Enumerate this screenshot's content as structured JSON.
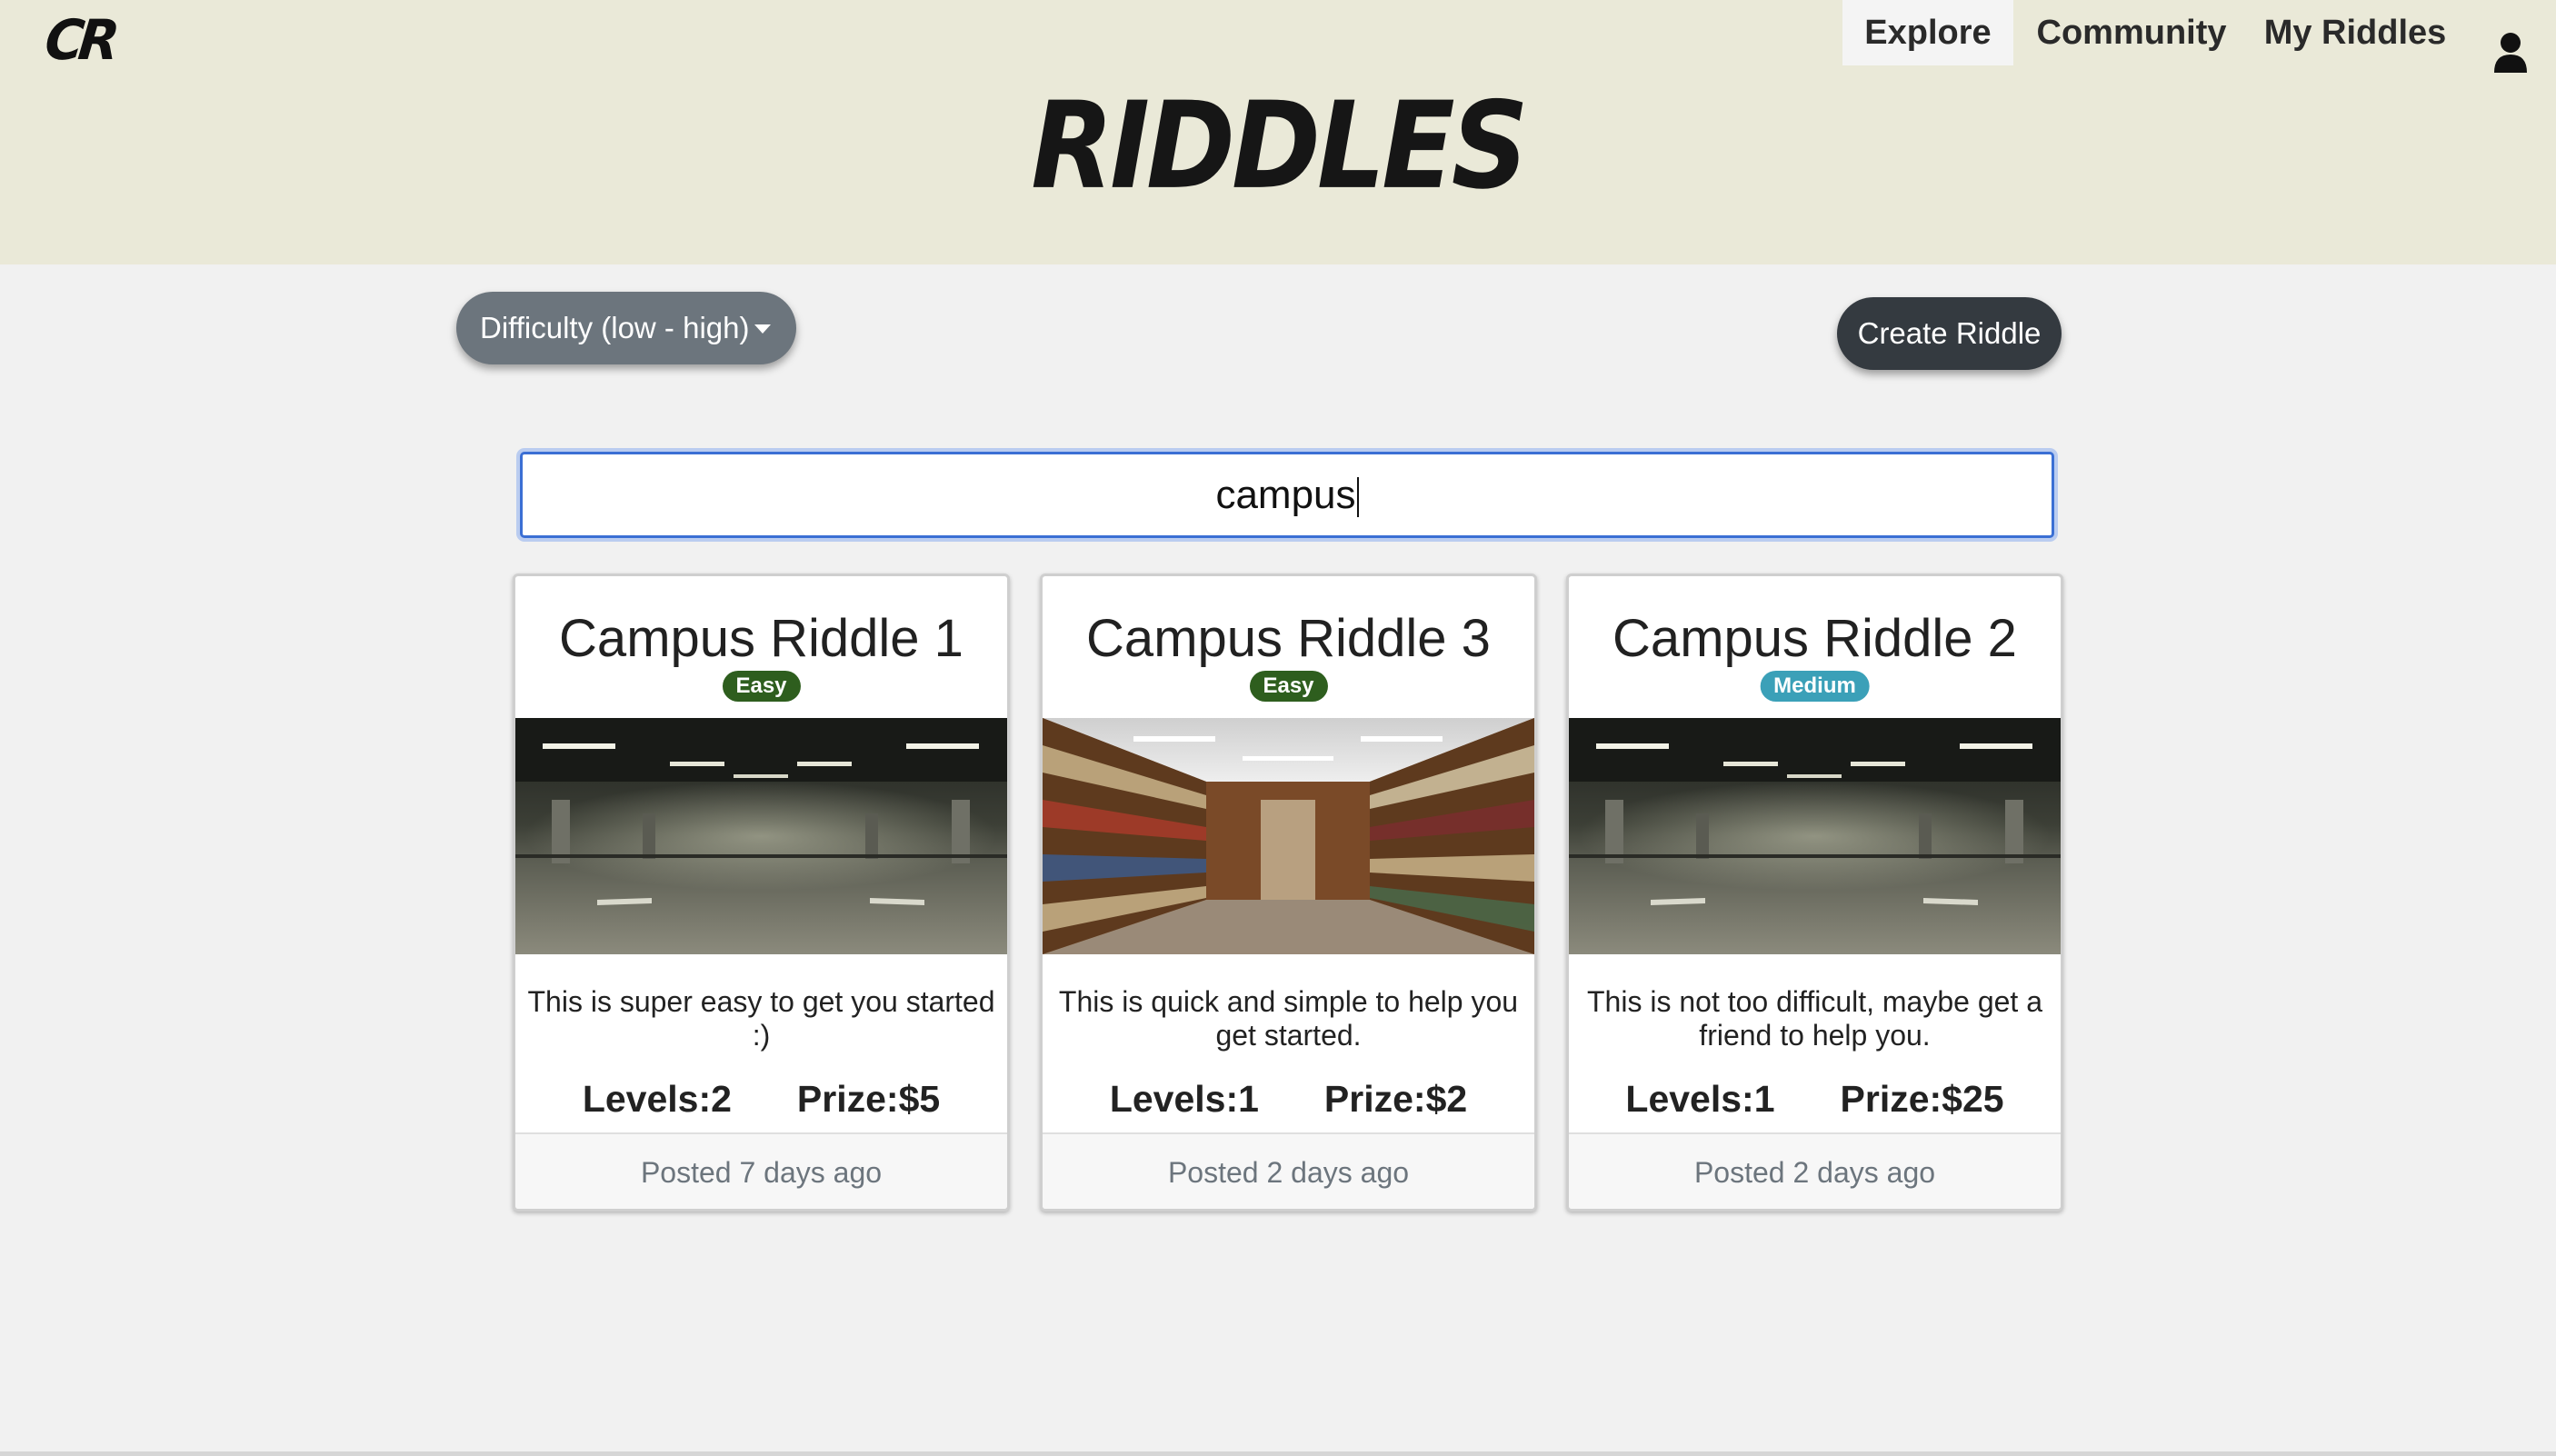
{
  "header": {
    "logo": "CR",
    "title": "RIDDLES",
    "background": "#eae9d8"
  },
  "nav": {
    "items": [
      {
        "label": "Explore",
        "active": true
      },
      {
        "label": "Community",
        "active": false
      },
      {
        "label": "My Riddles",
        "active": false
      }
    ],
    "user_icon": "user-icon"
  },
  "toolbar": {
    "sort_label": "Difficulty (low - high)",
    "create_label": "Create Riddle"
  },
  "search": {
    "value": "campus"
  },
  "cards": [
    {
      "title": "Campus Riddle 1",
      "difficulty": "Easy",
      "difficulty_color": "#2e5e1e",
      "image": "parking-garage",
      "description": "This is super easy to get you started :)",
      "levels": "Levels:2",
      "prize": "Prize:$5",
      "posted": "Posted 7 days ago"
    },
    {
      "title": "Campus Riddle 3",
      "difficulty": "Easy",
      "difficulty_color": "#2e5e1e",
      "image": "library-bookshelves",
      "description": "This is quick and simple to help you get started.",
      "levels": "Levels:1",
      "prize": "Prize:$2",
      "posted": "Posted 2 days ago"
    },
    {
      "title": "Campus Riddle 2",
      "difficulty": "Medium",
      "difficulty_color": "#3ba0b8",
      "image": "parking-garage",
      "description": "This is not too difficult, maybe get a friend to help you.",
      "levels": "Levels:1",
      "prize": "Prize:$25",
      "posted": "Posted 2 days ago"
    }
  ]
}
